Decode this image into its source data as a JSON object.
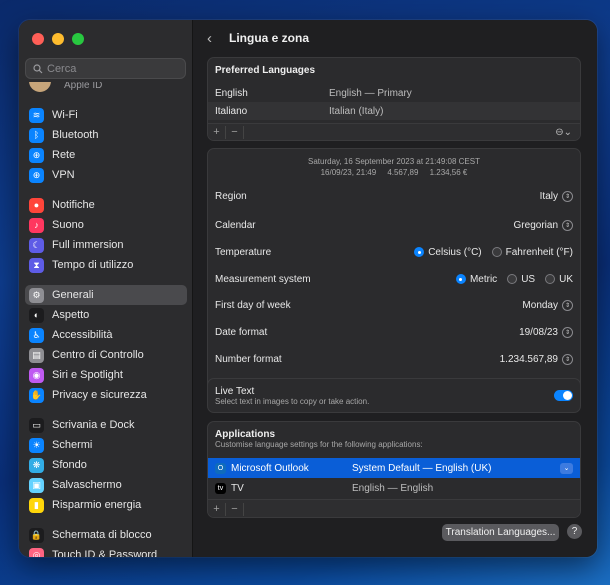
{
  "sidebar": {
    "search_placeholder": "Cerca",
    "apple_id_label": "Apple ID",
    "groups": [
      [
        {
          "label": "Wi-Fi",
          "icon": "wifi-icon",
          "color": "#0a84ff",
          "glyph": "≋"
        },
        {
          "label": "Bluetooth",
          "icon": "bluetooth-icon",
          "color": "#0a84ff",
          "glyph": "ᛒ"
        },
        {
          "label": "Rete",
          "icon": "network-icon",
          "color": "#0a84ff",
          "glyph": "⊕"
        },
        {
          "label": "VPN",
          "icon": "vpn-icon",
          "color": "#0a84ff",
          "glyph": "⊕"
        }
      ],
      [
        {
          "label": "Notifiche",
          "icon": "notifications-icon",
          "color": "#ff453a",
          "glyph": "●"
        },
        {
          "label": "Suono",
          "icon": "sound-icon",
          "color": "#ff375f",
          "glyph": "♪"
        },
        {
          "label": "Full immersion",
          "icon": "focus-icon",
          "color": "#5e5ce6",
          "glyph": "☾"
        },
        {
          "label": "Tempo di utilizzo",
          "icon": "screen-time-icon",
          "color": "#5e5ce6",
          "glyph": "⧗"
        }
      ],
      [
        {
          "label": "Generali",
          "icon": "gear-icon",
          "color": "#8e8e93",
          "glyph": "⚙",
          "active": true
        },
        {
          "label": "Aspetto",
          "icon": "appearance-icon",
          "color": "#1c1c1e",
          "glyph": "◐"
        },
        {
          "label": "Accessibilità",
          "icon": "accessibility-icon",
          "color": "#0a84ff",
          "glyph": "♿"
        },
        {
          "label": "Centro di Controllo",
          "icon": "control-center-icon",
          "color": "#8e8e93",
          "glyph": "▤"
        },
        {
          "label": "Siri e Spotlight",
          "icon": "siri-icon",
          "color": "#bf5af2",
          "glyph": "◉"
        },
        {
          "label": "Privacy e sicurezza",
          "icon": "privacy-hand-icon",
          "color": "#0a84ff",
          "glyph": "✋"
        }
      ],
      [
        {
          "label": "Scrivania e Dock",
          "icon": "dock-icon",
          "color": "#1c1c1e",
          "glyph": "▭"
        },
        {
          "label": "Schermi",
          "icon": "displays-icon",
          "color": "#0a84ff",
          "glyph": "☀"
        },
        {
          "label": "Sfondo",
          "icon": "wallpaper-icon",
          "color": "#32ade6",
          "glyph": "❋"
        },
        {
          "label": "Salvaschermo",
          "icon": "screensaver-icon",
          "color": "#64d2ff",
          "glyph": "▣"
        },
        {
          "label": "Risparmio energia",
          "icon": "battery-icon",
          "color": "#ffd60a",
          "glyph": "▮"
        }
      ],
      [
        {
          "label": "Schermata di blocco",
          "icon": "lock-icon",
          "color": "#1c1c1e",
          "glyph": "🔒"
        },
        {
          "label": "Touch ID & Password",
          "icon": "fingerprint-icon",
          "color": "#ff6482",
          "glyph": "◎"
        }
      ]
    ]
  },
  "header": {
    "title": "Lingua e zona",
    "back_icon": "chevron-left-icon"
  },
  "preferred_languages": {
    "title": "Preferred Languages",
    "rows": [
      {
        "name": "English",
        "detail": "English — Primary"
      },
      {
        "name": "Italiano",
        "detail": "Italian (Italy)"
      }
    ],
    "add": "+",
    "remove": "−"
  },
  "format_preview": {
    "line1": "Saturday, 16 September 2023 at 21:49:08 CEST",
    "line2": "16/09/23, 21:49     4.567,89     1.234,56 €"
  },
  "settings": {
    "region": {
      "label": "Region",
      "value": "Italy"
    },
    "calendar": {
      "label": "Calendar",
      "value": "Gregorian"
    },
    "temperature": {
      "label": "Temperature",
      "options": [
        "Celsius (°C)",
        "Fahrenheit (°F)"
      ],
      "selected": "Celsius (°C)"
    },
    "measurement": {
      "label": "Measurement system",
      "options": [
        "Metric",
        "US",
        "UK"
      ],
      "selected": "Metric"
    },
    "first_day": {
      "label": "First day of week",
      "value": "Monday"
    },
    "date_format": {
      "label": "Date format",
      "value": "19/08/23"
    },
    "number_format": {
      "label": "Number format",
      "value": "1.234.567,89"
    }
  },
  "live_text": {
    "title": "Live Text",
    "subtitle": "Select text in images to copy or take action.",
    "enabled": true
  },
  "applications": {
    "title": "Applications",
    "subtitle": "Customise language settings for the following applications:",
    "rows": [
      {
        "name": "Microsoft Outlook",
        "language": "System Default — English (UK)",
        "selected": true
      },
      {
        "name": "TV",
        "language": "English — English",
        "selected": false
      }
    ],
    "add": "+",
    "remove": "−"
  },
  "footer": {
    "translation_button": "Translation Languages...",
    "help": "?"
  }
}
